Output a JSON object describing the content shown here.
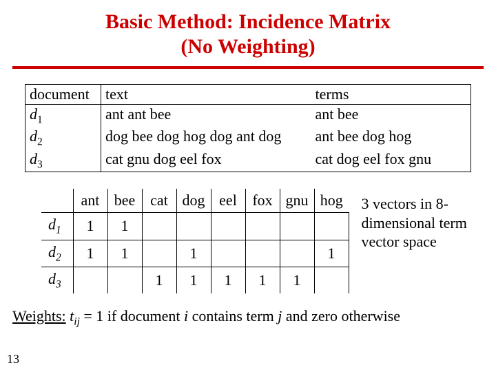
{
  "title_line1": "Basic Method: Incidence Matrix",
  "title_line2": "(No Weighting)",
  "top": {
    "hdr": {
      "c1": "document",
      "c2": "text",
      "c3": "terms"
    },
    "rows": [
      {
        "doc_letter": "d",
        "doc_sub": "1",
        "text": "ant ant bee",
        "terms": "ant bee"
      },
      {
        "doc_letter": "d",
        "doc_sub": "2",
        "text": "dog bee dog hog dog ant dog",
        "terms": "ant bee dog hog"
      },
      {
        "doc_letter": "d",
        "doc_sub": "3",
        "text": "cat gnu dog eel fox",
        "terms": "cat dog eel fox gnu"
      }
    ]
  },
  "matrix": {
    "terms": [
      "ant",
      "bee",
      "cat",
      "dog",
      "eel",
      "fox",
      "gnu",
      "hog"
    ],
    "rows": [
      {
        "doc_letter": "d",
        "doc_sub": "1",
        "v": [
          "1",
          "1",
          "",
          "",
          "",
          "",
          "",
          ""
        ]
      },
      {
        "doc_letter": "d",
        "doc_sub": "2",
        "v": [
          "1",
          "1",
          "",
          "1",
          "",
          "",
          "",
          "1"
        ]
      },
      {
        "doc_letter": "d",
        "doc_sub": "3",
        "v": [
          "",
          "",
          "1",
          "1",
          "1",
          "1",
          "1",
          ""
        ]
      }
    ]
  },
  "side_note": "3 vectors in 8-dimensional term vector space",
  "weights": {
    "lead": "Weights:",
    "t": "t",
    "ij": "ij",
    "mid": " = 1 if document ",
    "i": "i",
    "mid2": " contains term ",
    "j": "j",
    "tail": " and zero otherwise"
  },
  "pagenum": "13",
  "chart_data": {
    "type": "table",
    "title": "Incidence Matrix (No Weighting)",
    "columns": [
      "ant",
      "bee",
      "cat",
      "dog",
      "eel",
      "fox",
      "gnu",
      "hog"
    ],
    "rows": [
      "d1",
      "d2",
      "d3"
    ],
    "values": [
      [
        1,
        1,
        0,
        0,
        0,
        0,
        0,
        0
      ],
      [
        1,
        1,
        0,
        1,
        0,
        0,
        0,
        1
      ],
      [
        0,
        0,
        1,
        1,
        1,
        1,
        1,
        0
      ]
    ],
    "note": "t_ij = 1 if document i contains term j, 0 otherwise"
  }
}
